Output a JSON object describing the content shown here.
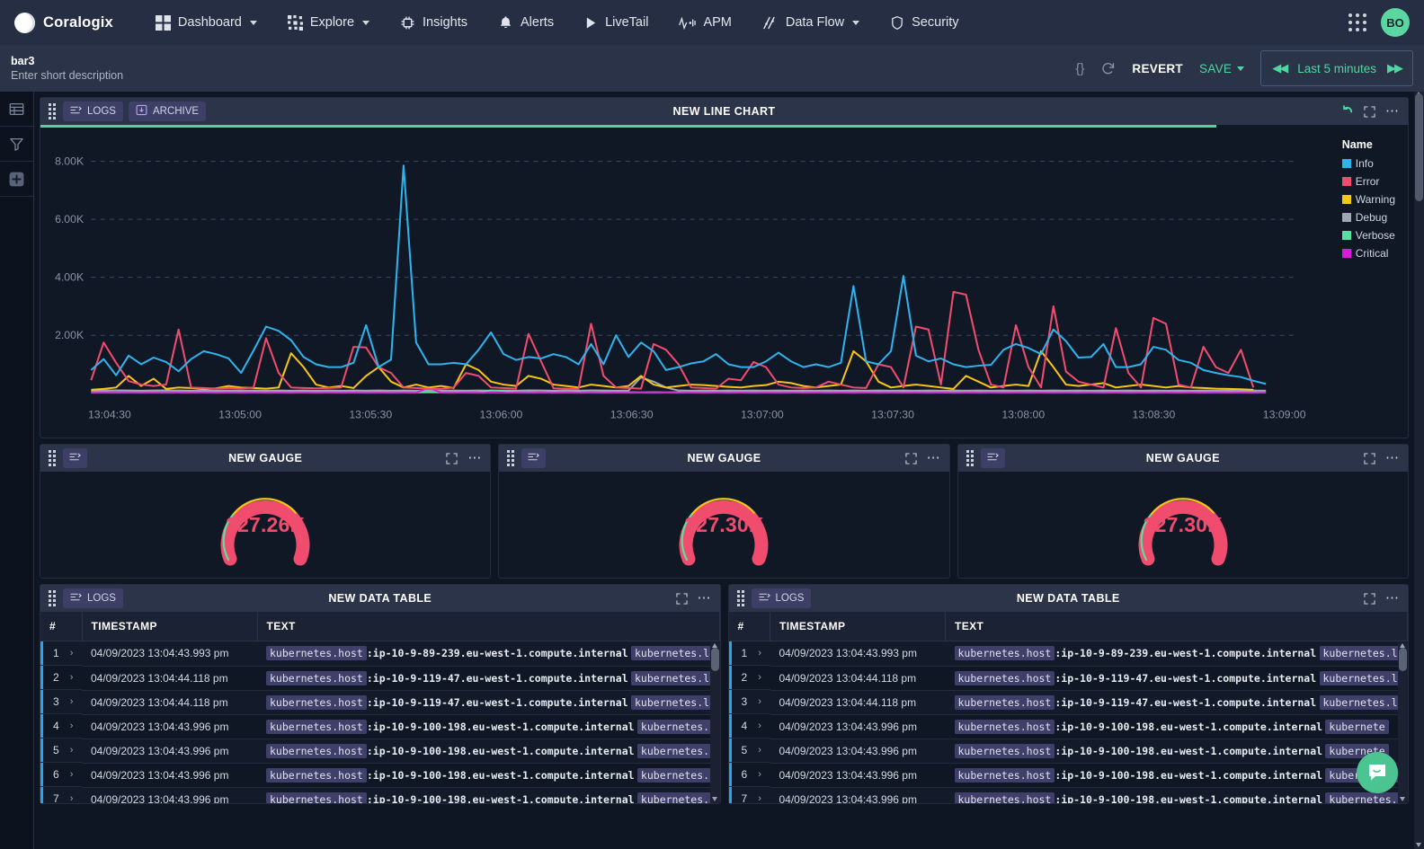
{
  "topnav": {
    "brand": "Coralogix",
    "items": [
      {
        "label": "Dashboard",
        "icon": "grid-icon",
        "caret": true
      },
      {
        "label": "Explore",
        "icon": "explore-icon",
        "caret": true
      },
      {
        "label": "Insights",
        "icon": "insights-icon",
        "caret": false
      },
      {
        "label": "Alerts",
        "icon": "bell-icon",
        "caret": false
      },
      {
        "label": "LiveTail",
        "icon": "play-icon",
        "caret": false
      },
      {
        "label": "APM",
        "icon": "apm-icon",
        "caret": false
      },
      {
        "label": "Data Flow",
        "icon": "dataflow-icon",
        "caret": true
      },
      {
        "label": "Security",
        "icon": "shield-icon",
        "caret": false
      }
    ],
    "avatar_initials": "BO"
  },
  "subheader": {
    "title": "bar3",
    "description": "Enter short description",
    "code_icon": "{}",
    "revert_label": "REVERT",
    "save_label": "SAVE",
    "timerange": "Last 5 minutes",
    "prev_arrow": "◀◀",
    "next_arrow": "▶▶"
  },
  "leftbar": {
    "items": [
      {
        "name": "table-icon"
      },
      {
        "name": "filter-icon"
      },
      {
        "name": "add-widget-icon"
      }
    ]
  },
  "panels": {
    "line_chart": {
      "title": "NEW LINE CHART",
      "tags": [
        {
          "label": "LOGS",
          "icon": "logs-icon"
        },
        {
          "label": "ARCHIVE",
          "icon": "archive-icon"
        }
      ],
      "progress_percent": 86
    },
    "gauges": [
      {
        "title": "NEW GAUGE",
        "value": "227.26K",
        "tag": "logs-icon"
      },
      {
        "title": "NEW GAUGE",
        "value": "227.30K",
        "tag": "logs-icon"
      },
      {
        "title": "NEW GAUGE",
        "value": "227.30K",
        "tag": "logs-icon"
      }
    ],
    "tables": [
      {
        "title": "NEW DATA TABLE",
        "tag": "LOGS",
        "columns": [
          "#",
          "TIMESTAMP",
          "TEXT"
        ],
        "rows": [
          {
            "n": "1",
            "ts": "04/09/2023 13:04:43.993 pm",
            "key": "kubernetes.host",
            "val": ":ip-10-9-89-239.eu-west-1.compute.internal",
            "key2": "kubernetes.la"
          },
          {
            "n": "2",
            "ts": "04/09/2023 13:04:44.118 pm",
            "key": "kubernetes.host",
            "val": ":ip-10-9-119-47.eu-west-1.compute.internal",
            "key2": "kubernetes.la"
          },
          {
            "n": "3",
            "ts": "04/09/2023 13:04:44.118 pm",
            "key": "kubernetes.host",
            "val": ":ip-10-9-119-47.eu-west-1.compute.internal",
            "key2": "kubernetes.la"
          },
          {
            "n": "4",
            "ts": "04/09/2023 13:04:43.996 pm",
            "key": "kubernetes.host",
            "val": ":ip-10-9-100-198.eu-west-1.compute.internal",
            "key2": "kubernetes."
          },
          {
            "n": "5",
            "ts": "04/09/2023 13:04:43.996 pm",
            "key": "kubernetes.host",
            "val": ":ip-10-9-100-198.eu-west-1.compute.internal",
            "key2": "kubernetes."
          },
          {
            "n": "6",
            "ts": "04/09/2023 13:04:43.996 pm",
            "key": "kubernetes.host",
            "val": ":ip-10-9-100-198.eu-west-1.compute.internal",
            "key2": "kubernetes."
          },
          {
            "n": "7",
            "ts": "04/09/2023 13:04:43.996 pm",
            "key": "kubernetes.host",
            "val": ":ip-10-9-100-198.eu-west-1.compute.internal",
            "key2": "kubernetes."
          }
        ]
      },
      {
        "title": "NEW DATA TABLE",
        "tag": "LOGS",
        "columns": [
          "#",
          "TIMESTAMP",
          "TEXT"
        ],
        "rows": [
          {
            "n": "1",
            "ts": "04/09/2023 13:04:43.993 pm",
            "key": "kubernetes.host",
            "val": ":ip-10-9-89-239.eu-west-1.compute.internal",
            "key2": "kubernetes.la"
          },
          {
            "n": "2",
            "ts": "04/09/2023 13:04:44.118 pm",
            "key": "kubernetes.host",
            "val": ":ip-10-9-119-47.eu-west-1.compute.internal",
            "key2": "kubernetes.la"
          },
          {
            "n": "3",
            "ts": "04/09/2023 13:04:44.118 pm",
            "key": "kubernetes.host",
            "val": ":ip-10-9-119-47.eu-west-1.compute.internal",
            "key2": "kubernetes.la"
          },
          {
            "n": "4",
            "ts": "04/09/2023 13:04:43.996 pm",
            "key": "kubernetes.host",
            "val": ":ip-10-9-100-198.eu-west-1.compute.internal",
            "key2": "kubernete"
          },
          {
            "n": "5",
            "ts": "04/09/2023 13:04:43.996 pm",
            "key": "kubernetes.host",
            "val": ":ip-10-9-100-198.eu-west-1.compute.internal",
            "key2": "kubernete"
          },
          {
            "n": "6",
            "ts": "04/09/2023 13:04:43.996 pm",
            "key": "kubernetes.host",
            "val": ":ip-10-9-100-198.eu-west-1.compute.internal",
            "key2": "kubernetes."
          },
          {
            "n": "7",
            "ts": "04/09/2023 13:04:43.996 pm",
            "key": "kubernetes.host",
            "val": ":ip-10-9-100-198.eu-west-1.compute.internal",
            "key2": "kubernetes."
          }
        ]
      }
    ]
  },
  "colors": {
    "accent_green": "#4fd6a0",
    "info": "#2fb3ec",
    "error": "#ef4c6e",
    "warning": "#f5c518",
    "debug": "#9ea7b3",
    "verbose": "#5ae0a0",
    "critical": "#d91ad9"
  },
  "chart_data": {
    "type": "line",
    "title": "NEW LINE CHART",
    "xlabel": "",
    "ylabel": "",
    "ylim": [
      0,
      8800
    ],
    "yticks": [
      2000,
      4000,
      6000,
      8000
    ],
    "ytick_labels": [
      "2.00K",
      "4.00K",
      "6.00K",
      "8.00K"
    ],
    "grid": true,
    "legend_title": "Name",
    "legend_position": "right",
    "xtick_labels": [
      "13:04:30",
      "13:05:00",
      "13:05:30",
      "13:06:00",
      "13:06:30",
      "13:07:00",
      "13:07:30",
      "13:08:00",
      "13:08:30",
      "13:09:00"
    ],
    "x": [
      0,
      1,
      2,
      3,
      4,
      5,
      6,
      7,
      8,
      9,
      10,
      11,
      12,
      13,
      14,
      15,
      16,
      17,
      18,
      19,
      20,
      21,
      22,
      23,
      24,
      25,
      26,
      27,
      28,
      29,
      30,
      31,
      32,
      33,
      34,
      35,
      36,
      37,
      38,
      39,
      40,
      41,
      42,
      43,
      44,
      45,
      46,
      47,
      48,
      49,
      50,
      51,
      52,
      53,
      54,
      55,
      56,
      57,
      58,
      59,
      60,
      61,
      62,
      63,
      64,
      65,
      66,
      67,
      68,
      69,
      70,
      71,
      72,
      73,
      74,
      75,
      76,
      77,
      78,
      79,
      80,
      81,
      82,
      83,
      84,
      85,
      86,
      87,
      88,
      89,
      90,
      91,
      92,
      93,
      94
    ],
    "series": [
      {
        "name": "Info",
        "color": "#2fb3ec",
        "values": [
          800,
          1180,
          620,
          1300,
          1000,
          1230,
          1080,
          760,
          1180,
          1450,
          1350,
          1200,
          700,
          1480,
          2300,
          2150,
          1830,
          1250,
          1000,
          900,
          900,
          1050,
          2350,
          900,
          1160,
          7860,
          1750,
          1000,
          1000,
          1050,
          1000,
          1500,
          2100,
          1350,
          1150,
          1250,
          1200,
          1350,
          1250,
          1000,
          1700,
          1000,
          2000,
          1250,
          1750,
          1450,
          800,
          900,
          1030,
          1100,
          1350,
          1000,
          900,
          900,
          1100,
          1400,
          1100,
          900,
          1000,
          900,
          1050,
          3700,
          1100,
          1000,
          1450,
          4050,
          1300,
          1100,
          1200,
          1000,
          900,
          950,
          980,
          1500,
          1700,
          1560,
          1350,
          2200,
          1800,
          1230,
          1250,
          1700,
          900,
          900,
          1000,
          1600,
          1500,
          1150,
          1050,
          800,
          700,
          620,
          560,
          430,
          320
        ]
      },
      {
        "name": "Error",
        "color": "#ef4c6e",
        "values": [
          450,
          1750,
          1050,
          420,
          300,
          250,
          300,
          2200,
          200,
          180,
          160,
          180,
          160,
          200,
          1900,
          700,
          200,
          180,
          170,
          180,
          200,
          1600,
          1580,
          900,
          700,
          200,
          180,
          160,
          150,
          200,
          700,
          600,
          200,
          180,
          160,
          2050,
          1100,
          170,
          160,
          150,
          2400,
          600,
          200,
          180,
          160,
          1700,
          1500,
          1000,
          200,
          180,
          160,
          500,
          450,
          1080,
          900,
          300,
          200,
          180,
          200,
          400,
          300,
          200,
          180,
          1000,
          900,
          200,
          2300,
          2200,
          300,
          3500,
          3400,
          1500,
          300,
          200,
          2350,
          900,
          200,
          3000,
          750,
          400,
          300,
          200,
          2250,
          700,
          200,
          2600,
          2400,
          300,
          200,
          1600,
          900,
          700,
          1500,
          200
        ]
      },
      {
        "name": "Warning",
        "color": "#f5c518",
        "values": [
          120,
          150,
          200,
          600,
          250,
          500,
          150,
          200,
          180,
          150,
          170,
          250,
          200,
          180,
          160,
          200,
          1380,
          900,
          300,
          200,
          250,
          180,
          600,
          900,
          400,
          200,
          300,
          200,
          250,
          180,
          1000,
          800,
          400,
          300,
          250,
          600,
          500,
          300,
          250,
          200,
          300,
          250,
          200,
          250,
          600,
          300,
          200,
          250,
          300,
          280,
          250,
          220,
          200,
          250,
          280,
          400,
          350,
          250,
          200,
          250,
          300,
          1450,
          1100,
          400,
          200,
          250,
          300,
          250,
          200,
          150,
          600,
          400,
          200,
          250,
          300,
          250,
          1450,
          900,
          300,
          250,
          300,
          350,
          200,
          250,
          300,
          250,
          200,
          250,
          200,
          180,
          160,
          150,
          140,
          120
        ]
      },
      {
        "name": "Debug",
        "color": "#9ea7b3",
        "values": [
          90,
          95,
          100,
          95,
          90,
          95,
          100,
          95,
          90,
          95,
          90,
          95,
          90,
          95,
          90,
          95,
          90,
          95,
          90,
          95,
          90,
          95,
          90,
          95,
          90,
          95,
          90,
          95,
          90,
          95,
          90,
          95,
          90,
          95,
          90,
          100,
          95,
          90,
          95,
          90,
          100,
          95,
          90,
          95,
          550,
          400,
          200,
          95,
          90,
          95,
          90,
          95,
          90,
          95,
          90,
          95,
          90,
          95,
          90,
          95,
          90,
          95,
          90,
          95,
          90,
          95,
          90,
          95,
          90,
          95,
          90,
          95,
          90,
          95,
          90,
          95,
          90,
          95,
          90,
          95,
          90,
          95,
          90,
          95,
          90,
          95,
          90,
          95,
          90,
          95,
          90,
          95,
          90,
          95,
          90
        ]
      },
      {
        "name": "Verbose",
        "color": "#5ae0a0",
        "values": [
          30,
          35,
          30,
          35,
          30,
          35,
          30,
          35,
          30,
          35,
          30,
          35,
          30,
          35,
          30,
          35,
          30,
          35,
          30,
          35,
          30,
          35,
          30,
          35,
          30,
          35,
          30,
          35,
          30,
          35,
          30,
          35,
          100,
          80,
          30,
          35,
          30,
          35,
          30,
          35,
          30,
          35,
          30,
          35,
          30,
          35,
          30,
          35,
          30,
          35,
          30,
          35,
          30,
          35,
          30,
          35,
          30,
          35,
          30,
          35,
          30,
          35,
          30,
          35,
          30,
          35,
          30,
          35,
          30,
          35,
          30,
          35,
          30,
          35,
          30,
          35,
          30,
          35,
          30,
          35,
          30,
          35,
          30,
          35,
          30,
          35,
          30,
          35,
          30,
          35,
          30,
          35,
          30,
          35,
          30
        ]
      },
      {
        "name": "Critical",
        "color": "#d91ad9",
        "values": [
          15,
          18,
          15,
          18,
          15,
          18,
          15,
          18,
          15,
          18,
          15,
          18,
          15,
          18,
          15,
          18,
          15,
          18,
          15,
          18,
          15,
          18,
          15,
          18,
          15,
          18,
          15,
          200,
          18,
          15,
          18,
          15,
          18,
          15,
          18,
          15,
          18,
          15,
          18,
          15,
          18,
          15,
          18,
          15,
          18,
          15,
          18,
          15,
          18,
          15,
          18,
          15,
          18,
          15,
          18,
          15,
          18,
          15,
          18,
          15,
          18,
          15,
          18,
          15,
          18,
          15,
          18,
          15,
          18,
          15,
          18,
          15,
          18,
          15,
          18,
          15,
          18,
          15,
          18,
          15,
          18,
          15,
          18,
          15,
          18,
          15,
          18,
          15,
          18,
          15,
          18,
          15,
          18,
          15,
          18
        ]
      }
    ]
  }
}
